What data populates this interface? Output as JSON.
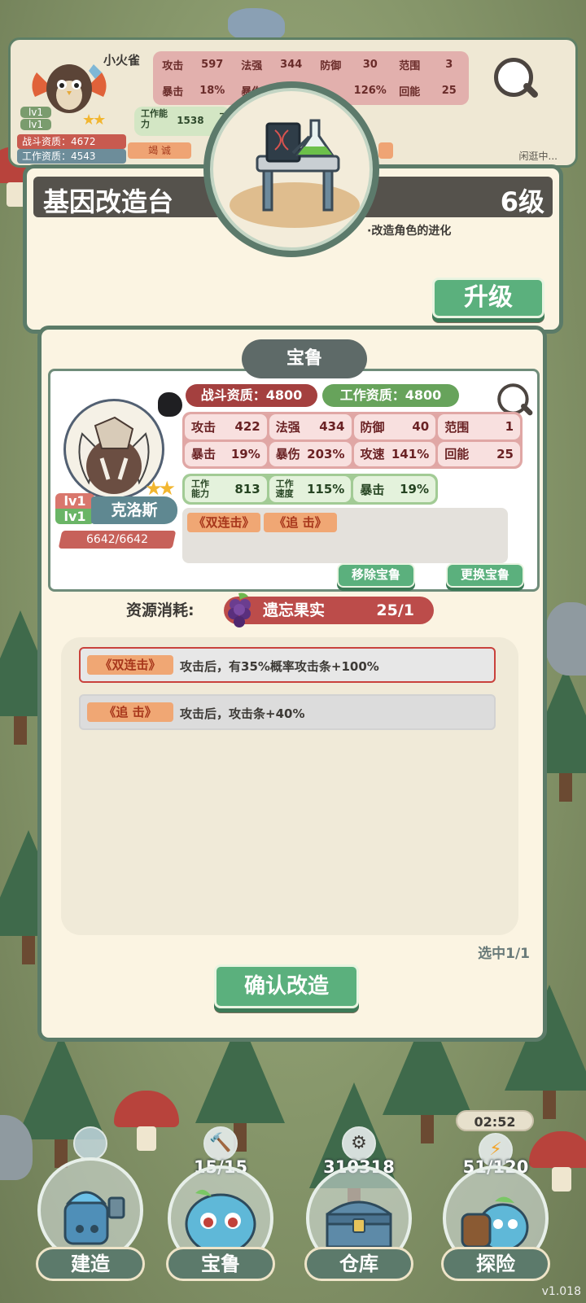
{
  "top_card": {
    "name": "小火雀",
    "stats_row1": [
      {
        "label": "攻击",
        "value": "597"
      },
      {
        "label": "法强",
        "value": "344"
      },
      {
        "label": "防御",
        "value": "30"
      },
      {
        "label": "范围",
        "value": "3"
      }
    ],
    "stats_row2": [
      {
        "label": "暴击",
        "value": "18%"
      },
      {
        "label": "暴伤",
        "value": ""
      },
      {
        "label": "",
        "value": "126%"
      },
      {
        "label": "回能",
        "value": "25"
      }
    ],
    "lv1": "lv1",
    "lv2": "lv1",
    "battle_res": "战斗资质：4672",
    "work_res": "工作资质：4543",
    "work_label": "工作能力",
    "work_value": "1538",
    "work_label2": "工",
    "tag": "竭 诚",
    "status": "闲逛中..."
  },
  "building": {
    "title": "基因改造台",
    "level": "6级",
    "description": "·改造角色的进化",
    "upgrade_label": "升级"
  },
  "modal": {
    "tab_title": "宝鲁",
    "pet": {
      "name": "克洛斯",
      "lv_top": "lv1",
      "lv_bottom": "lv1",
      "hp": "6642/6642",
      "battle_res": "战斗资质：4800",
      "work_res": "工作资质：4800",
      "stats": [
        {
          "label": "攻击",
          "value": "422"
        },
        {
          "label": "法强",
          "value": "434"
        },
        {
          "label": "防御",
          "value": "40"
        },
        {
          "label": "范围",
          "value": "1"
        },
        {
          "label": "暴击",
          "value": "19%"
        },
        {
          "label": "暴伤",
          "value": "203%"
        },
        {
          "label": "攻速",
          "value": "141%"
        },
        {
          "label": "回能",
          "value": "25"
        }
      ],
      "work_stats": [
        {
          "label": "工作能力",
          "value": "813"
        },
        {
          "label": "工作速度",
          "value": "115%"
        },
        {
          "label": "暴击",
          "value": "19%"
        }
      ],
      "skills": [
        "双连击",
        "追 击"
      ],
      "stars": 2
    },
    "remove_label": "移除宝鲁",
    "replace_label": "更换宝鲁",
    "cost_label": "资源消耗:",
    "cost_item": "遗忘果实",
    "cost_count": "25/1",
    "skill_options": [
      {
        "name": "双连击",
        "desc": "攻击后，有35%概率攻击条+100%",
        "selected": true
      },
      {
        "name": "追 击",
        "desc": "攻击后，攻击条+40%",
        "selected": false
      }
    ],
    "selected_count": "选中1/1",
    "confirm_label": "确认改造"
  },
  "nav": {
    "timer": "02:52",
    "items": [
      {
        "label": "建造",
        "counter": ""
      },
      {
        "label": "宝鲁",
        "counter": "15/15"
      },
      {
        "label": "仓库",
        "counter": "310318"
      },
      {
        "label": "探险",
        "counter": "51/120"
      }
    ]
  },
  "version": "v1.018"
}
